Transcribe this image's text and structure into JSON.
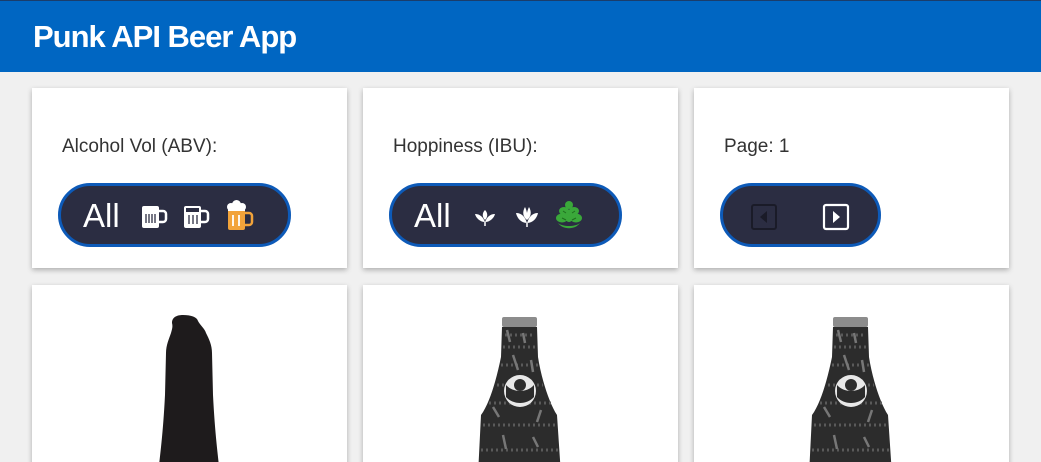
{
  "app": {
    "title": "Punk API Beer App"
  },
  "filters": {
    "abv": {
      "label": "Alcohol Vol (ABV):",
      "all_label": "All",
      "icons": [
        "mug-low-icon",
        "mug-mid-icon",
        "mug-full-icon"
      ],
      "selected": "mug-full-icon"
    },
    "ibu": {
      "label": "Hoppiness (IBU):",
      "all_label": "All",
      "icons": [
        "hop-low-icon",
        "hop-mid-icon",
        "hop-high-icon"
      ],
      "selected": "hop-high-icon"
    },
    "page": {
      "label": "Page: 1",
      "prev": "prev-page-icon",
      "next": "next-page-icon"
    }
  },
  "beers": [
    {
      "bottle": "dark-champagne-bottle"
    },
    {
      "bottle": "textured-bottle"
    },
    {
      "bottle": "textured-bottle"
    }
  ],
  "colors": {
    "header": "#0066c2",
    "pill_bg": "#2b2d42",
    "pill_border": "#0d5ab8",
    "mug_selected": "#f2a33a",
    "hop_selected": "#3aa83a"
  }
}
